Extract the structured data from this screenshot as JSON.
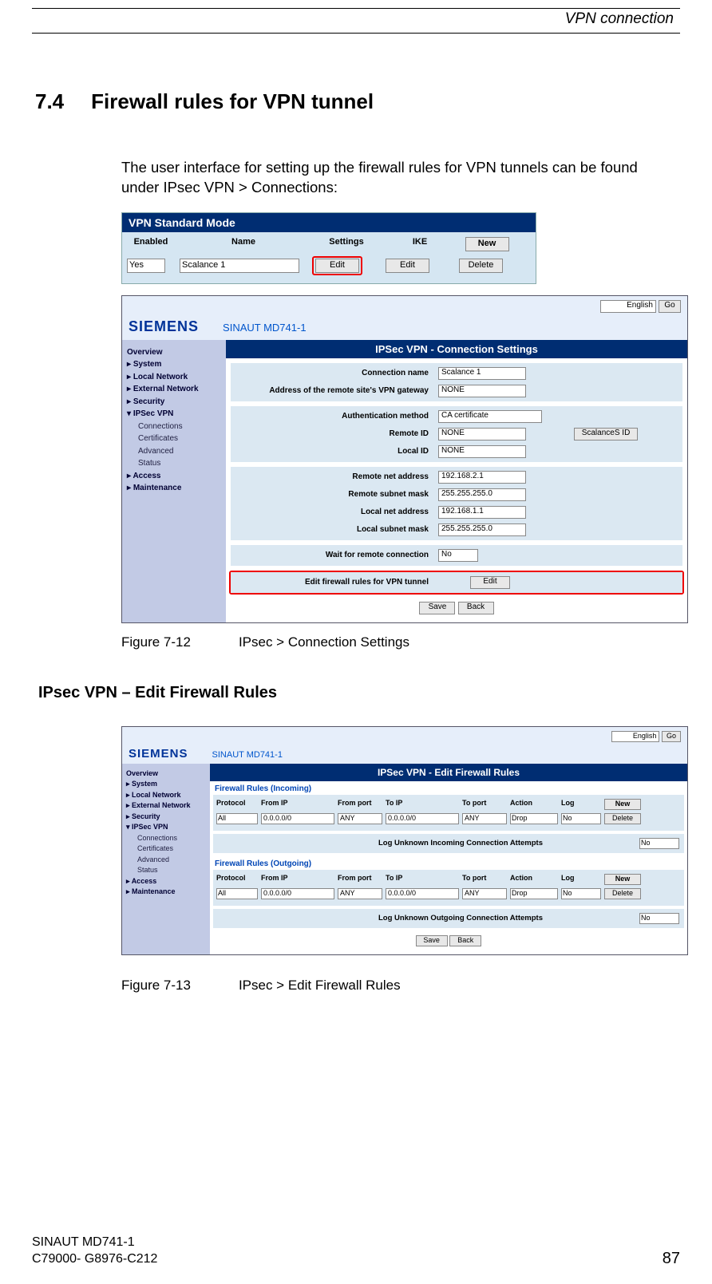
{
  "header": {
    "running_title": "VPN connection"
  },
  "section": {
    "number": "7.4",
    "title": "Firewall rules for VPN tunnel",
    "intro": "The user interface for setting up the firewall rules for VPN tunnels can be found under IPsec VPN > Connections:"
  },
  "fig1": {
    "title": "VPN Standard Mode",
    "headers": {
      "enabled": "Enabled",
      "name": "Name",
      "settings": "Settings",
      "ike": "IKE",
      "new": "New"
    },
    "row": {
      "enabled_val": "Yes",
      "name_val": "Scalance 1",
      "settings_btn": "Edit",
      "ike_btn": "Edit",
      "del_btn": "Delete"
    }
  },
  "fig2": {
    "lang_val": "English",
    "go_btn": "Go",
    "brand": "SIEMENS",
    "subbrand": "SINAUT MD741-1",
    "nav": {
      "overview": "Overview",
      "system": "System",
      "localnet": "Local Network",
      "extnet": "External Network",
      "security": "Security",
      "ipsec": "IPSec VPN",
      "conn": "Connections",
      "cert": "Certificates",
      "adv": "Advanced",
      "status": "Status",
      "access": "Access",
      "maint": "Maintenance"
    },
    "main_title": "IPSec VPN - Connection Settings",
    "rows": {
      "conn_name_lbl": "Connection name",
      "conn_name_val": "Scalance 1",
      "gw_addr_lbl": "Address of the remote site's VPN gateway",
      "gw_addr_val": "NONE",
      "auth_lbl": "Authentication method",
      "auth_val": "CA certificate",
      "rid_lbl": "Remote ID",
      "rid_val": "NONE",
      "rid_btn": "ScalanceS ID",
      "lid_lbl": "Local ID",
      "lid_val": "NONE",
      "rna_lbl": "Remote net address",
      "rna_val": "192.168.2.1",
      "rsm_lbl": "Remote subnet mask",
      "rsm_val": "255.255.255.0",
      "lna_lbl": "Local net address",
      "lna_val": "192.168.1.1",
      "lsm_lbl": "Local subnet mask",
      "lsm_val": "255.255.255.0",
      "wait_lbl": "Wait for remote connection",
      "wait_val": "No",
      "edit_fw_lbl": "Edit firewall rules for VPN tunnel",
      "edit_fw_btn": "Edit",
      "save_btn": "Save",
      "back_btn": "Back"
    },
    "caption_num": "Figure 7-12",
    "caption_txt": "IPsec > Connection Settings"
  },
  "subheading": "IPsec VPN – Edit Firewall Rules",
  "fig3": {
    "lang_val": "English",
    "go_btn": "Go",
    "brand": "SIEMENS",
    "subbrand": "SINAUT MD741-1",
    "nav": {
      "overview": "Overview",
      "system": "System",
      "localnet": "Local Network",
      "extnet": "External Network",
      "security": "Security",
      "ipsec": "IPSec VPN",
      "conn": "Connections",
      "cert": "Certificates",
      "adv": "Advanced",
      "status": "Status",
      "access": "Access",
      "maint": "Maintenance"
    },
    "main_title": "IPSec VPN - Edit Firewall Rules",
    "in_title": "Firewall Rules (Incoming)",
    "out_title": "Firewall Rules (Outgoing)",
    "hdr": {
      "proto": "Protocol",
      "fip": "From IP",
      "fport": "From port",
      "tip": "To IP",
      "tport": "To port",
      "action": "Action",
      "log": "Log",
      "new": "New",
      "del": "Delete"
    },
    "row": {
      "proto_val": "All",
      "fip_val": "0.0.0.0/0",
      "fport_val": "ANY",
      "tip_val": "0.0.0.0/0",
      "tport_val": "ANY",
      "action_val": "Drop",
      "log_val": "No"
    },
    "log_in_lbl": "Log Unknown Incoming Connection Attempts",
    "log_in_val": "No",
    "log_out_lbl": "Log Unknown Outgoing Connection Attempts",
    "log_out_val": "No",
    "save_btn": "Save",
    "back_btn": "Back",
    "caption_num": "Figure 7-13",
    "caption_txt": "IPsec > Edit Firewall Rules"
  },
  "footer": {
    "line1": "SINAUT MD741-1",
    "line2": "C79000- G8976-C212",
    "page": "87"
  }
}
